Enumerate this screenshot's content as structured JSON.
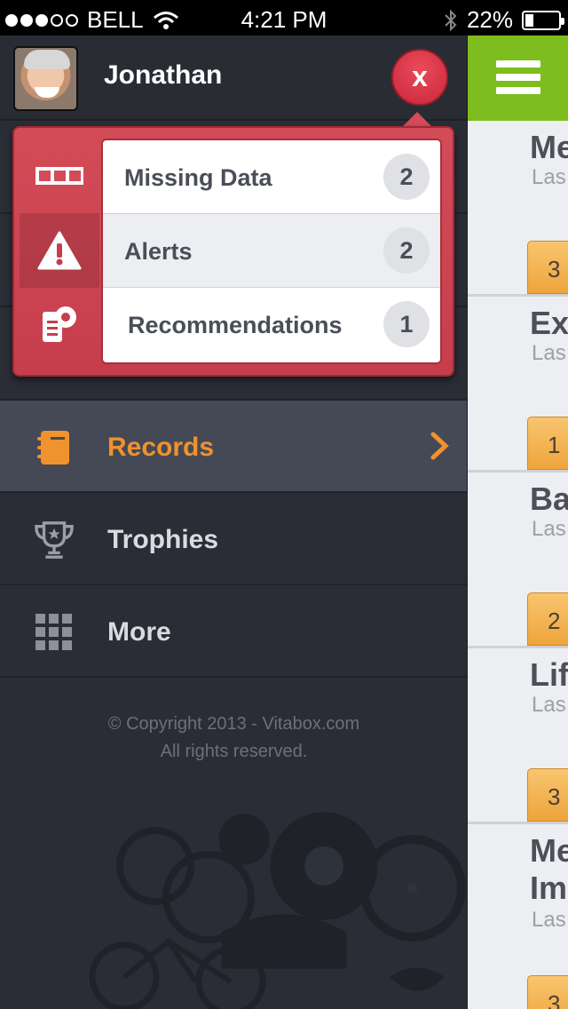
{
  "status_bar": {
    "carrier": "BELL",
    "time": "4:21 PM",
    "battery": "22%",
    "signal_bars_filled": 3,
    "signal_bars_total": 5,
    "battery_level": 0.22
  },
  "sidebar": {
    "user_name": "Jonathan",
    "close_label": "x",
    "notifications": [
      {
        "label": "Missing Data",
        "count": "2",
        "icon": "grid-row-icon"
      },
      {
        "label": "Alerts",
        "count": "2",
        "icon": "warning-icon"
      },
      {
        "label": "Recommendations",
        "count": "1",
        "icon": "recommendation-icon"
      }
    ],
    "nav_items": [
      {
        "label": "Records",
        "icon": "notebook-icon",
        "active": true
      },
      {
        "label": "Trophies",
        "icon": "trophy-icon",
        "active": false
      },
      {
        "label": "More",
        "icon": "grid-icon",
        "active": false
      }
    ],
    "copyright_line1": "© Copyright 2013 - Vitabox.com",
    "copyright_line2": "All rights reserved."
  },
  "content": {
    "cards": [
      {
        "title": "Me",
        "subtitle": "Las",
        "badge": "3"
      },
      {
        "title": "Ex",
        "subtitle": "Las",
        "badge": "1"
      },
      {
        "title": "Ba",
        "subtitle": "Las",
        "badge": "2"
      },
      {
        "title": "Lif",
        "subtitle": "Las",
        "badge": "3"
      },
      {
        "title": "Me",
        "title2": "Im",
        "subtitle": "Las",
        "badge": "3"
      }
    ]
  },
  "colors": {
    "accent_green": "#7dbd1d",
    "alert_red": "#d44b58",
    "active_orange": "#f0922d",
    "sidebar_bg": "#2a2d35"
  }
}
